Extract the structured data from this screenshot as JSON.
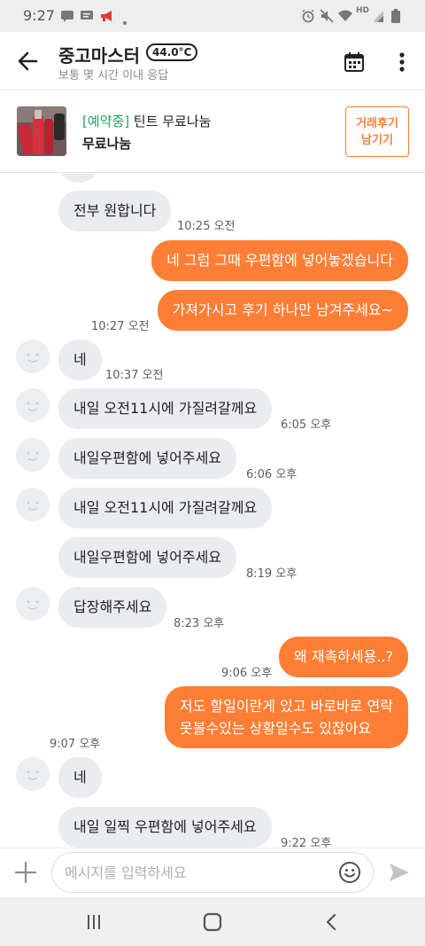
{
  "status_bar": {
    "time": "9:27",
    "icons": [
      "chat-notification-icon",
      "message-icon",
      "megaphone-icon",
      "dot-icon",
      "alarm-icon",
      "mute-icon",
      "wifi-icon",
      "hd-icon",
      "signal-icon",
      "battery-icon"
    ],
    "hd_label": "HD"
  },
  "header": {
    "back_icon": "back-arrow-icon",
    "title": "중고마스터",
    "temperature": "44.0°C",
    "subtitle": "보통 몇 시간 이내 응답",
    "actions": [
      "calendar-icon",
      "more-vertical-icon"
    ]
  },
  "product": {
    "status": "[예약중]",
    "title": "틴트 무료나눔",
    "price": "무료나눔",
    "review_button": [
      "거래후기",
      "남기기"
    ]
  },
  "messages": [
    {
      "side": "in",
      "text": "전부 원합니다",
      "time": "10:25 오전",
      "avatar": false
    },
    {
      "side": "out",
      "text": "네 그럼 그때 우편함에 넣어놓겠습니다",
      "time": ""
    },
    {
      "side": "out",
      "text": "가져가시고 후기 하나만 남겨주세요~",
      "time": "10:27 오전"
    },
    {
      "side": "in",
      "text": "네",
      "time": "10:37 오전",
      "avatar": true
    },
    {
      "side": "in",
      "text": "내일 오전11시에 가질려갈께요",
      "time": "6:05 오후",
      "avatar": true
    },
    {
      "side": "in",
      "text": "내일우편함에 넣어주세요",
      "time": "6:06 오후",
      "avatar": true
    },
    {
      "side": "in",
      "text": "내일 오전11시에 가질려갈께요",
      "time": "",
      "avatar": true
    },
    {
      "side": "in",
      "text": "내일우편함에 넣어주세요",
      "time": "8:19 오후",
      "avatar": false
    },
    {
      "side": "in",
      "text": "답장해주세요",
      "time": "8:23 오후",
      "avatar": true
    },
    {
      "side": "out",
      "text": "왜 재촉하세용..?",
      "time": "9:06 오후"
    },
    {
      "side": "out",
      "lines": [
        "저도 할일이란게 있고 바로바로 연락",
        "못볼수있는 상황일수도 있잖아요"
      ],
      "time": "9:07 오후"
    },
    {
      "side": "in",
      "text": "네",
      "time": "",
      "avatar": true
    },
    {
      "side": "in",
      "text": "내일 일찍 우편함에 넣어주세요",
      "time": "9:22 오후",
      "avatar": false
    }
  ],
  "input": {
    "placeholder": "메시지를 입력하세요",
    "value": "",
    "icons": [
      "plus-icon",
      "emoji-icon",
      "send-icon"
    ]
  },
  "nav": {
    "icons": [
      "recent-apps-icon",
      "home-icon",
      "back-icon"
    ]
  },
  "colors": {
    "accent": "#ff7e36",
    "status_green": "#21a65b",
    "bubble_in": "#ebecf0",
    "text_primary": "#212124",
    "text_secondary": "#868b94"
  }
}
